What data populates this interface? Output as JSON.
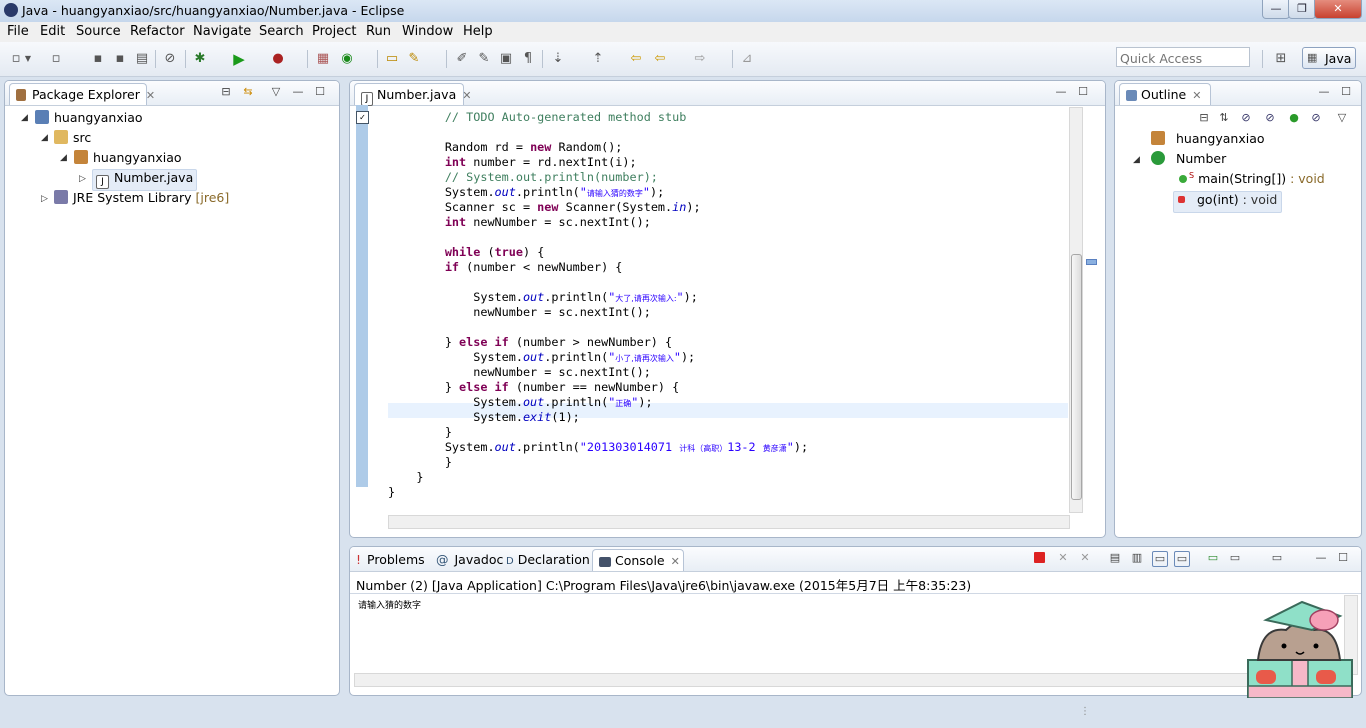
{
  "window": {
    "title": "Java - huangyanxiao/src/huangyanxiao/Number.java - Eclipse",
    "controls": [
      "—",
      "❐",
      "✕"
    ]
  },
  "menu": [
    "File",
    "Edit",
    "Source",
    "Refactor",
    "Navigate",
    "Search",
    "Project",
    "Run",
    "Window",
    "Help"
  ],
  "toolbar": {
    "quick_access_placeholder": "Quick Access",
    "perspective": "Java"
  },
  "package_explorer": {
    "tab": "Package Explorer",
    "tree": [
      {
        "label": "huangyanxiao",
        "icon": "java-project-icon"
      },
      {
        "label": "src",
        "icon": "source-folder-icon"
      },
      {
        "label": "huangyanxiao",
        "icon": "package-icon"
      },
      {
        "label": "Number.java",
        "icon": "java-file-icon"
      },
      {
        "label": "JRE System Library",
        "suffix": "[jre6]",
        "icon": "library-icon"
      }
    ]
  },
  "editor": {
    "tab": "Number.java",
    "lines": [
      {
        "indent": "        ",
        "parts": [
          [
            "cm",
            "// TODO Auto-generated method stub"
          ]
        ]
      },
      {
        "indent": "",
        "parts": []
      },
      {
        "indent": "        ",
        "parts": [
          [
            "",
            "Random rd = "
          ],
          [
            "kw",
            "new"
          ],
          [
            "",
            " Random();"
          ]
        ]
      },
      {
        "indent": "        ",
        "parts": [
          [
            "kw",
            "int"
          ],
          [
            "",
            " number = rd.nextInt(i);"
          ]
        ]
      },
      {
        "indent": "        ",
        "parts": [
          [
            "cm",
            "// System.out.println(number);"
          ]
        ]
      },
      {
        "indent": "        ",
        "parts": [
          [
            "",
            "System."
          ],
          [
            "it",
            "out"
          ],
          [
            "",
            ".println("
          ],
          [
            "str",
            "\""
          ],
          [
            "cn",
            "请输入猜的数字"
          ],
          [
            "str",
            "\""
          ],
          [
            "",
            ");"
          ]
        ]
      },
      {
        "indent": "        ",
        "parts": [
          [
            "",
            "Scanner sc = "
          ],
          [
            "kw",
            "new"
          ],
          [
            "",
            " Scanner(System."
          ],
          [
            "it",
            "in"
          ],
          [
            "",
            ");"
          ]
        ]
      },
      {
        "indent": "        ",
        "parts": [
          [
            "kw",
            "int"
          ],
          [
            "",
            " newNumber = sc.nextInt();"
          ]
        ]
      },
      {
        "indent": "",
        "parts": []
      },
      {
        "indent": "        ",
        "parts": [
          [
            "kw",
            "while"
          ],
          [
            "",
            " ("
          ],
          [
            "kw",
            "true"
          ],
          [
            "",
            ") {"
          ]
        ]
      },
      {
        "indent": "        ",
        "parts": [
          [
            "kw",
            "if"
          ],
          [
            "",
            " (number < newNumber) {"
          ]
        ]
      },
      {
        "indent": "",
        "parts": []
      },
      {
        "indent": "            ",
        "parts": [
          [
            "",
            "System."
          ],
          [
            "it",
            "out"
          ],
          [
            "",
            ".println("
          ],
          [
            "str",
            "\""
          ],
          [
            "cn",
            "大了,请再次输入:"
          ],
          [
            "str",
            "\""
          ],
          [
            "",
            ");"
          ]
        ]
      },
      {
        "indent": "            ",
        "parts": [
          [
            "",
            "newNumber = sc.nextInt();"
          ]
        ]
      },
      {
        "indent": "",
        "parts": []
      },
      {
        "indent": "        ",
        "parts": [
          [
            "",
            "} "
          ],
          [
            "kw",
            "else if"
          ],
          [
            "",
            " (number > newNumber) {"
          ]
        ]
      },
      {
        "indent": "            ",
        "parts": [
          [
            "",
            "System."
          ],
          [
            "it",
            "out"
          ],
          [
            "",
            ".println("
          ],
          [
            "str",
            "\""
          ],
          [
            "cn",
            "小了,请再次输入"
          ],
          [
            "str",
            "\""
          ],
          [
            "",
            ");"
          ]
        ]
      },
      {
        "indent": "            ",
        "parts": [
          [
            "",
            "newNumber = sc.nextInt();"
          ]
        ]
      },
      {
        "indent": "        ",
        "parts": [
          [
            "",
            "} "
          ],
          [
            "kw",
            "else if"
          ],
          [
            "",
            " (number == newNumber) {"
          ]
        ]
      },
      {
        "indent": "            ",
        "parts": [
          [
            "",
            "System."
          ],
          [
            "it",
            "out"
          ],
          [
            "",
            ".println("
          ],
          [
            "str",
            "\""
          ],
          [
            "cn",
            "正确"
          ],
          [
            "str",
            "\""
          ],
          [
            "",
            ");"
          ]
        ]
      },
      {
        "indent": "            ",
        "parts": [
          [
            "",
            "System."
          ],
          [
            "it",
            "exit"
          ],
          [
            "",
            "(1);"
          ]
        ]
      },
      {
        "indent": "        ",
        "parts": [
          [
            "",
            "}"
          ]
        ]
      },
      {
        "indent": "        ",
        "parts": [
          [
            "",
            "System."
          ],
          [
            "it",
            "out"
          ],
          [
            "",
            ".println("
          ],
          [
            "str",
            "\"201303014071 "
          ],
          [
            "cn",
            "计科（高职）"
          ],
          [
            "str",
            "13-2 "
          ],
          [
            "cn",
            "黄彦潇"
          ],
          [
            "str",
            "\""
          ],
          [
            "",
            ");"
          ]
        ]
      },
      {
        "indent": "        ",
        "parts": [
          [
            "",
            "}"
          ]
        ]
      },
      {
        "indent": "    ",
        "parts": [
          [
            "",
            "}"
          ]
        ]
      },
      {
        "indent": "",
        "parts": [
          [
            "",
            "}"
          ]
        ]
      }
    ]
  },
  "outline": {
    "tab": "Outline",
    "items": [
      {
        "label": "huangyanxiao",
        "icon": "package-icon"
      },
      {
        "label": "Number",
        "icon": "class-icon"
      },
      {
        "label": "main(String[])",
        "ret": " : void",
        "icon": "public-method-icon",
        "mark": "S"
      },
      {
        "label": "go(int)",
        "ret": " : void",
        "icon": "private-method-icon"
      }
    ]
  },
  "bottom": {
    "tabs": [
      "Problems",
      "Javadoc",
      "Declaration",
      "Console"
    ],
    "tab_icons": [
      "!",
      "@",
      "D",
      ""
    ],
    "console_header": "Number (2) [Java Application] C:\\Program Files\\Java\\jre6\\bin\\javaw.exe (2015年5月7日 上午8:35:23)",
    "console_output": "请输入猜的数字"
  },
  "colors": {
    "keyword": "#7f0055",
    "comment": "#3f7f5f",
    "string": "#2a00ff",
    "field": "#0000c0"
  }
}
